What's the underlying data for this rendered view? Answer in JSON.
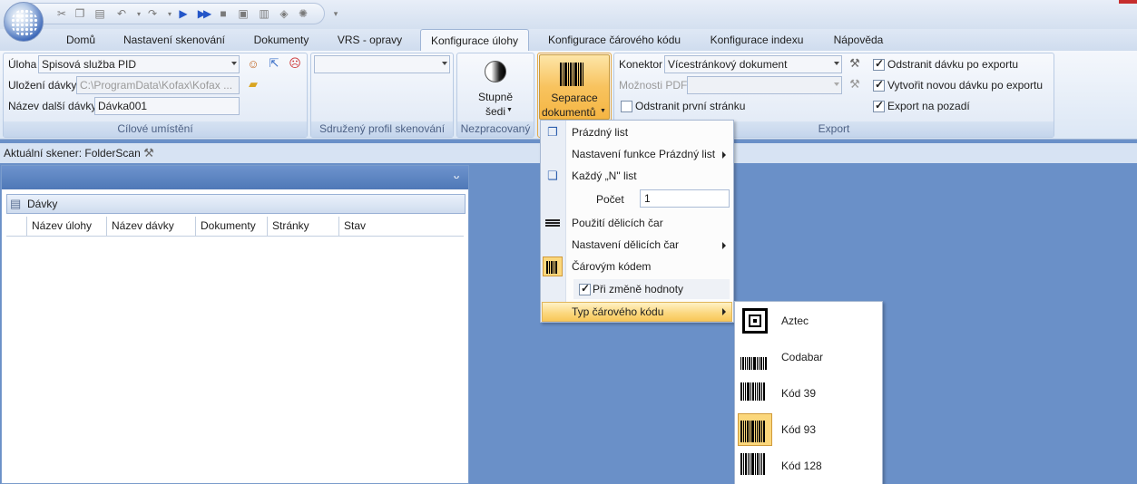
{
  "tabs": [
    "Domů",
    "Nastavení skenování",
    "Dokumenty",
    "VRS - opravy",
    "Konfigurace úlohy",
    "Konfigurace čárového kódu",
    "Konfigurace indexu",
    "Nápověda"
  ],
  "active_tab": "Konfigurace úlohy",
  "target_group": {
    "job_label": "Úloha",
    "job_value": "Spisová služba PID",
    "save_label": "Uložení dávky",
    "save_value": "C:\\ProgramData\\Kofax\\Kofax ...",
    "next_batch_label": "Název další dávky",
    "next_batch_value": "Dávka001",
    "caption": "Cílové umístění"
  },
  "scan_profile_group": {
    "value": "",
    "caption": "Sdružený profil skenování"
  },
  "raw_group": {
    "button_line1": "Stupně",
    "button_line2": "šedi",
    "caption": "Nezpracovaný"
  },
  "separation": {
    "line1": "Separace",
    "line2": "dokumentů"
  },
  "export_group": {
    "connector_label": "Konektor",
    "connector_value": "Vícestránkový dokument",
    "pdf_label": "Možnosti PDF",
    "pdf_value": "",
    "remove_first_label": "Odstranit první stránku",
    "remove_batch_label": "Odstranit dávku po exportu",
    "new_batch_label": "Vytvořit novou dávku po exportu",
    "background_label": "Export na pozadí",
    "caption": "Export"
  },
  "status": {
    "scanner_text": "Aktuální skener: FolderScan"
  },
  "batch_panel": {
    "pin_glyph": "ᴗ",
    "caption": "Dávky",
    "columns": [
      "Název úlohy",
      "Název dávky",
      "Dokumenty",
      "Stránky",
      "Stav"
    ]
  },
  "separation_menu": {
    "blank": "Prázdný list",
    "blank_settings": "Nastavení funkce Prázdný list",
    "every_n": "Každý „N\" list",
    "count_label": "Počet",
    "count_value": "1",
    "use_patch": "Použití dělicích čar",
    "patch_settings": "Nastavení dělicích čar",
    "by_barcode": "Čárovým kódem",
    "on_change": "Při změně hodnoty",
    "barcode_type": "Typ čárového kódu"
  },
  "barcode_submenu": [
    "Aztec",
    "Codabar",
    "Kód 39",
    "Kód 93",
    "Kód 128"
  ],
  "colors": {
    "accent": "#4f78b7",
    "highlight": "#fbd77c",
    "desktop": "#6a90c8"
  }
}
